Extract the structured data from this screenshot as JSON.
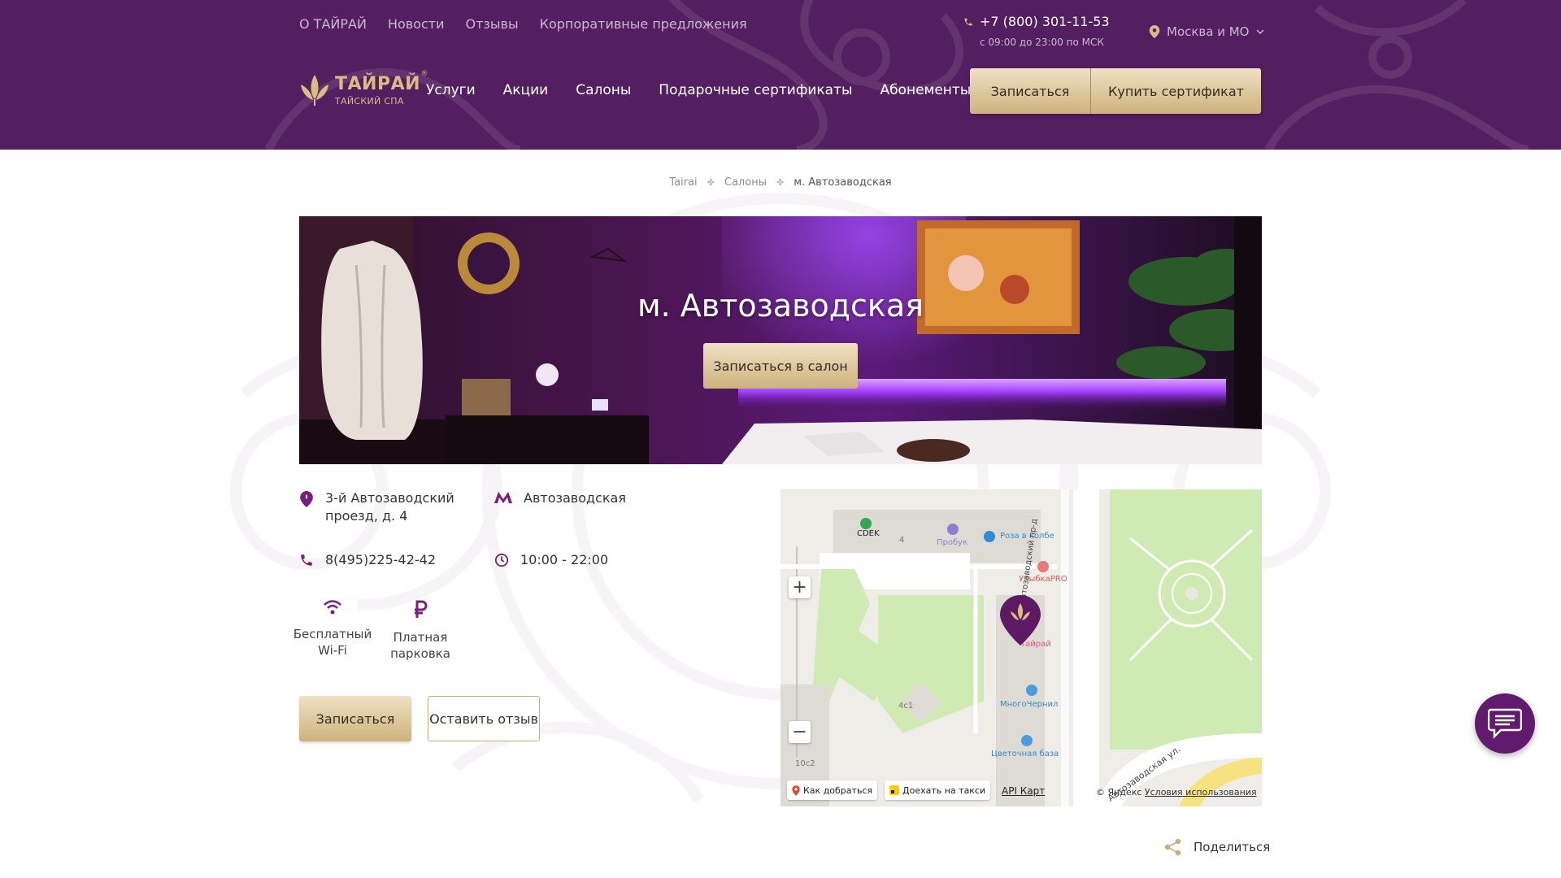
{
  "top_nav": [
    {
      "label": "О ТАЙРАЙ"
    },
    {
      "label": "Новости"
    },
    {
      "label": "Отзывы"
    },
    {
      "label": "Корпоративные предложения"
    }
  ],
  "contact": {
    "phone": "+7 (800) 301-11-53",
    "hours": "с 09:00 до 23:00 по МСК"
  },
  "region": {
    "label": "Москва и МО"
  },
  "logo": {
    "name": "ТАЙРАЙ",
    "registered": "®",
    "subtitle": "ТАЙСКИЙ СПА"
  },
  "main_nav": [
    {
      "label": "Услуги"
    },
    {
      "label": "Акции"
    },
    {
      "label": "Салоны"
    },
    {
      "label": "Подарочные сертификаты"
    },
    {
      "label": "Абонементы"
    }
  ],
  "header_buttons": {
    "book": "Записаться",
    "certificate": "Купить сертификат"
  },
  "breadcrumb": {
    "home": "Tairai",
    "salons": "Салоны",
    "current": "м. Автозаводская",
    "separator": "✤"
  },
  "hero": {
    "title": "м. Автозаводская",
    "button": "Записаться в салон"
  },
  "salon": {
    "address": "3-й Автозаводский проезд, д. 4",
    "metro": "Автозаводская",
    "phone": "8(495)225-42-42",
    "hours": "10:00 - 22:00"
  },
  "amenities": [
    {
      "label": "Бесплатный Wi-Fi",
      "icon": "wifi-icon"
    },
    {
      "label": "Платная парковка",
      "icon": "ruble-icon"
    }
  ],
  "actions": {
    "book": "Записаться",
    "review": "Оставить отзыв"
  },
  "map": {
    "zoom_in": "+",
    "zoom_out": "−",
    "labels": {
      "cdek": "CDEK",
      "probuk": "Пробук",
      "roza": "Роза в колбе",
      "ulybka": "УлыбкаPRO",
      "tairai": "Тайрай",
      "mnogochernil": "МногоЧернил",
      "cvetochnaya": "Цветочная база",
      "street_proezd": "3-й Автозаводский пр-д",
      "street_ul": "Автозаводская ул.",
      "bld_4": "4",
      "bld_4c1": "4с1",
      "bld_10c2": "10с2"
    },
    "route_label": "Как добраться",
    "taxi_label": "Доехать на такси",
    "api_label": "API Карт",
    "copyright": "© Яндекс",
    "terms": "Условия использования"
  },
  "share": {
    "label": "Поделиться"
  },
  "colors": {
    "brand_purple": "#531f60",
    "accent_purple": "#7a1f7e",
    "gold": "#d8bd84",
    "button_gold": "#cdb27d",
    "chat_purple": "#621a6e"
  }
}
